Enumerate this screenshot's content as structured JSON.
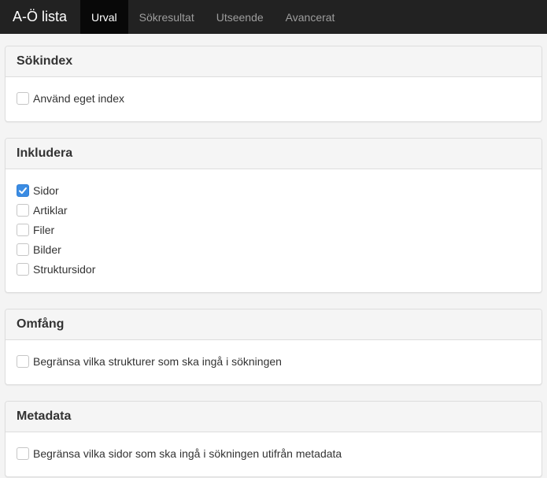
{
  "navbar": {
    "brand": "A-Ö lista",
    "tabs": [
      {
        "label": "Urval",
        "active": true
      },
      {
        "label": "Sökresultat",
        "active": false
      },
      {
        "label": "Utseende",
        "active": false
      },
      {
        "label": "Avancerat",
        "active": false
      }
    ]
  },
  "panels": [
    {
      "title": "Sökindex",
      "options": [
        {
          "label": "Använd eget index",
          "checked": false
        }
      ]
    },
    {
      "title": "Inkludera",
      "options": [
        {
          "label": "Sidor",
          "checked": true
        },
        {
          "label": "Artiklar",
          "checked": false
        },
        {
          "label": "Filer",
          "checked": false
        },
        {
          "label": "Bilder",
          "checked": false
        },
        {
          "label": "Struktursidor",
          "checked": false
        }
      ]
    },
    {
      "title": "Omfång",
      "options": [
        {
          "label": "Begränsa vilka strukturer som ska ingå i sökningen",
          "checked": false
        }
      ]
    },
    {
      "title": "Metadata",
      "options": [
        {
          "label": "Begränsa vilka sidor som ska ingå i sökningen utifrån metadata",
          "checked": false
        }
      ]
    }
  ],
  "colors": {
    "navbar_bg": "#222222",
    "active_tab_bg": "#080808",
    "checkbox_checked": "#3b8ce3"
  }
}
